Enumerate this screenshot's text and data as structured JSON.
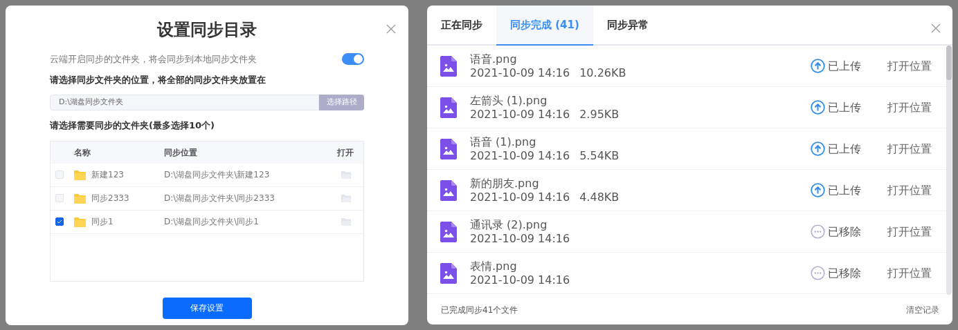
{
  "sync_dialog": {
    "title": "设置同步目录",
    "cloud_sync": {
      "label": "云端开启同步的文件夹，将会同步到本地同步文件夹",
      "on": true
    },
    "location_label": "请选择同步文件夹的位置，将全部的同步文件夹放置在",
    "path": {
      "value": "D:\\湖盘同步文件夹",
      "button": "选择路径"
    },
    "folders_label": "请选择需要同步的文件夹(最多选择10个)",
    "table": {
      "columns": [
        "名称",
        "同步位置",
        "打开"
      ],
      "rows": [
        {
          "name": "新建123",
          "location": "D:\\湖盘同步文件夹\\新建123",
          "checked": false
        },
        {
          "name": "同步2333",
          "location": "D:\\湖盘同步文件夹\\同步2333",
          "checked": false
        },
        {
          "name": "同步1",
          "location": "D:\\湖盘同步文件夹\\同步1",
          "checked": true
        }
      ]
    },
    "save_button": "保存设置"
  },
  "transfer_dialog": {
    "tabs": [
      {
        "label": "正在同步",
        "selected": false
      },
      {
        "label": "同步完成 (41)",
        "selected": true
      },
      {
        "label": "同步异常",
        "selected": false
      }
    ],
    "files": [
      {
        "name": "语音.png",
        "time": "2021-10-09 14:16",
        "size": "10.26KB",
        "status": "已上传",
        "kind": "uploaded",
        "action": "打开位置"
      },
      {
        "name": "左箭头 (1).png",
        "time": "2021-10-09 14:16",
        "size": "2.95KB",
        "status": "已上传",
        "kind": "uploaded",
        "action": "打开位置"
      },
      {
        "name": "语音 (1).png",
        "time": "2021-10-09 14:16",
        "size": "5.54KB",
        "status": "已上传",
        "kind": "uploaded",
        "action": "打开位置"
      },
      {
        "name": "新的朋友.png",
        "time": "2021-10-09 14:16",
        "size": "4.48KB",
        "status": "已上传",
        "kind": "uploaded",
        "action": "打开位置"
      },
      {
        "name": "通讯录 (2).png",
        "time": "2021-10-09 14:16",
        "status": "已移除",
        "kind": "removed",
        "action": "打开位置"
      },
      {
        "name": "表情.png",
        "time": "2021-10-09 14:16",
        "status": "已移除",
        "kind": "removed",
        "action": "打开位置"
      }
    ],
    "footer": {
      "summary": "已完成同步41个文件",
      "clear": "清空记录"
    }
  }
}
